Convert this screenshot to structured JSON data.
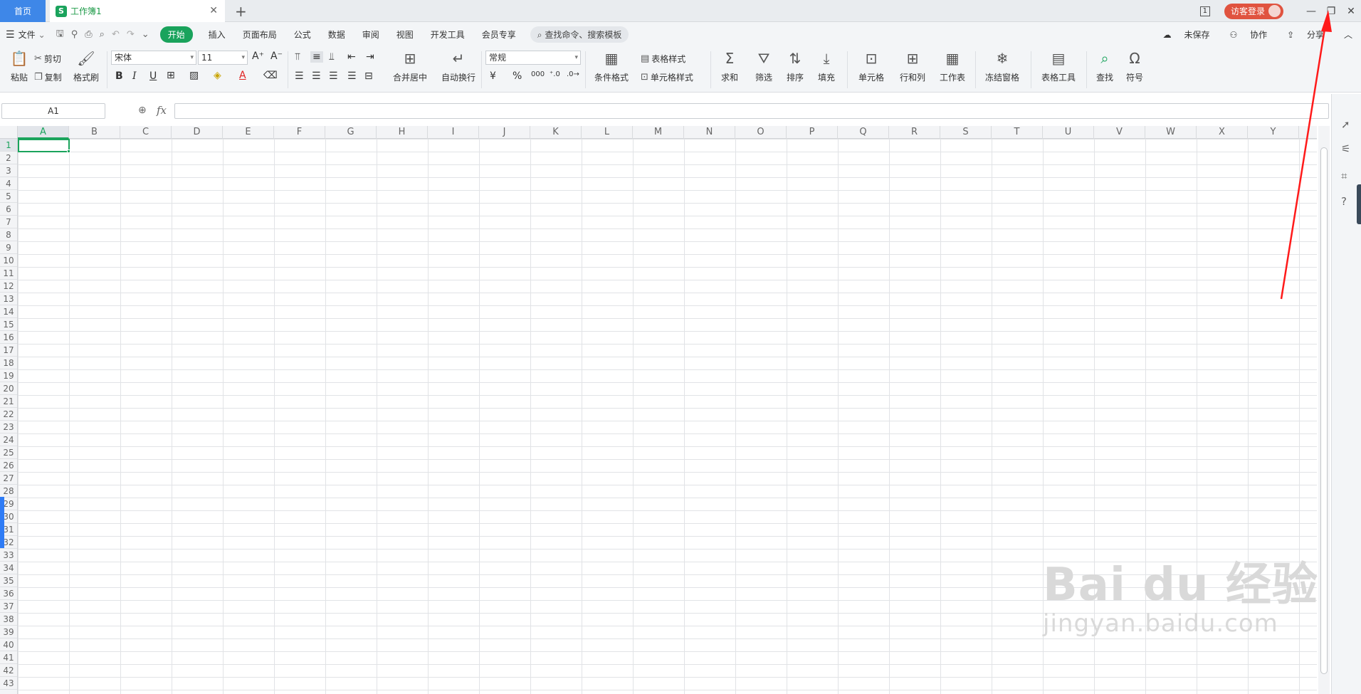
{
  "titlebar": {
    "home_tab": "首页",
    "doc_tab": "工作簿1",
    "doc_icon": "S",
    "new_tab": "+",
    "win_count": "1",
    "login": "访客登录"
  },
  "menu": {
    "file": "文件",
    "tabs": [
      "开始",
      "插入",
      "页面布局",
      "公式",
      "数据",
      "审阅",
      "视图",
      "开发工具",
      "会员专享"
    ],
    "search": "查找命令、搜索模板",
    "unsaved": "未保存",
    "collab": "协作",
    "share": "分享"
  },
  "ribbon": {
    "paste": "粘贴",
    "cut": "剪切",
    "copy": "复制",
    "format_painter": "格式刷",
    "font_name": "宋体",
    "font_size": "11",
    "merge_center": "合并居中",
    "wrap_text": "自动换行",
    "number_format": "常规",
    "cond_format": "条件格式",
    "table_style": "表格样式",
    "cell_style": "单元格样式",
    "sum": "求和",
    "filter": "筛选",
    "sort": "排序",
    "fill": "填充",
    "cell": "单元格",
    "row_col": "行和列",
    "worksheet": "工作表",
    "freeze": "冻结窗格",
    "table_tools": "表格工具",
    "find": "查找",
    "symbol": "符号"
  },
  "formula_bar": {
    "name_box": "A1",
    "fx": "fx",
    "value": ""
  },
  "grid": {
    "columns": [
      "A",
      "B",
      "C",
      "D",
      "E",
      "F",
      "G",
      "H",
      "I",
      "J",
      "K",
      "L",
      "M",
      "N",
      "O",
      "P",
      "Q",
      "R",
      "S",
      "T",
      "U",
      "V",
      "W",
      "X",
      "Y"
    ],
    "rows": [
      "1",
      "2",
      "3",
      "4",
      "5",
      "6",
      "7",
      "8",
      "9",
      "10",
      "11",
      "12",
      "13",
      "14",
      "15",
      "16",
      "17",
      "18",
      "19",
      "20",
      "21",
      "22",
      "23",
      "24",
      "25",
      "26",
      "27",
      "28",
      "29",
      "30",
      "31",
      "32",
      "33",
      "34",
      "35",
      "36",
      "37",
      "38",
      "39",
      "40",
      "41",
      "42",
      "43"
    ],
    "selected_cell": "A1"
  },
  "watermark": {
    "line1": "Bai du 经验",
    "line2": "jingyan.baidu.com"
  },
  "colors": {
    "accent_green": "#1aa35c",
    "home_blue": "#3e87e8",
    "login_red": "#e0533f",
    "arrow_red": "#ff1a1a"
  }
}
